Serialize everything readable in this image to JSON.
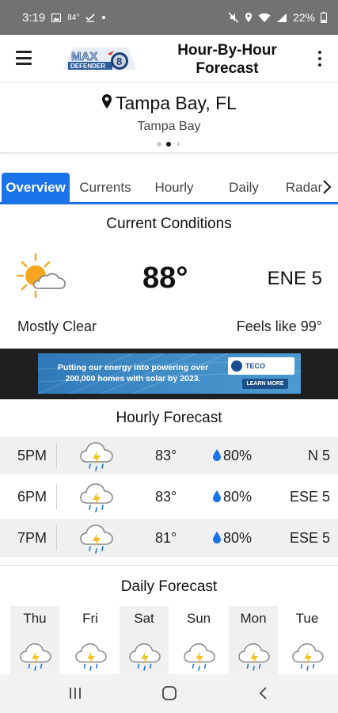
{
  "status_bar": {
    "time": "3:19",
    "temp": "84°",
    "battery": "22%"
  },
  "header": {
    "logo_text": "MAX DEFENDER 8",
    "title": "Hour-By-Hour Forecast"
  },
  "location": {
    "name": "Tampa Bay, FL",
    "subtitle": "Tampa Bay",
    "page_count": 2,
    "active_page": 2
  },
  "tabs": [
    {
      "label": "Overview",
      "active": true
    },
    {
      "label": "Currents",
      "active": false
    },
    {
      "label": "Hourly",
      "active": false
    },
    {
      "label": "Daily",
      "active": false
    },
    {
      "label": "Radar",
      "active": false
    }
  ],
  "current": {
    "title": "Current Conditions",
    "icon": "partly-sunny-icon",
    "temp": "88°",
    "wind": "ENE  5",
    "condition": "Mostly Clear",
    "feels_like": "Feels like 99°"
  },
  "ad": {
    "text": "Putting our energy into powering over 200,000 homes with solar by 2023.",
    "brand": "TECO",
    "cta": "LEARN MORE"
  },
  "hourly": {
    "title": "Hourly Forecast",
    "rows": [
      {
        "time": "5PM",
        "icon": "thunderstorm-icon",
        "temp": "83°",
        "precip": "80%",
        "wind": "N  5"
      },
      {
        "time": "6PM",
        "icon": "thunderstorm-icon",
        "temp": "83°",
        "precip": "80%",
        "wind": "ESE  5"
      },
      {
        "time": "7PM",
        "icon": "thunderstorm-icon",
        "temp": "81°",
        "precip": "80%",
        "wind": "ESE  5"
      }
    ]
  },
  "daily": {
    "title": "Daily Forecast",
    "days": [
      {
        "name": "Thu",
        "icon": "thunderstorm-icon"
      },
      {
        "name": "Fri",
        "icon": "thunderstorm-icon"
      },
      {
        "name": "Sat",
        "icon": "thunderstorm-icon"
      },
      {
        "name": "Sun",
        "icon": "thunderstorm-icon"
      },
      {
        "name": "Mon",
        "icon": "thunderstorm-icon"
      },
      {
        "name": "Tue",
        "icon": "thunderstorm-icon"
      }
    ]
  },
  "colors": {
    "accent": "#1a73e8",
    "sun": "#f4a71e",
    "drop": "#1a73e8"
  }
}
